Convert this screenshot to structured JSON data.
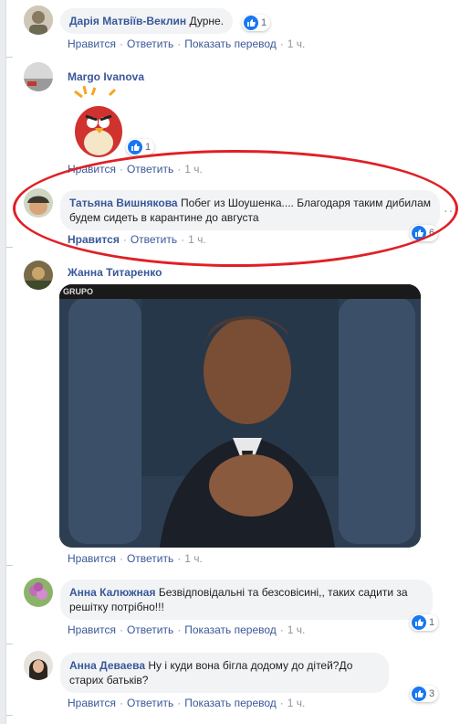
{
  "common": {
    "like": "Нравится",
    "reply": "Ответить",
    "translate": "Показать перевод",
    "sep": "·"
  },
  "colors": {
    "link": "#385898",
    "like_blue": "#1877f2",
    "bubble": "#f2f3f5",
    "highlight_oval": "#e01f26"
  },
  "comments": [
    {
      "name": "Дарія Матвіїв-Веклин",
      "text": "Дурне.",
      "time": "1 ч.",
      "reactions": "1"
    },
    {
      "name": "Margo Ivanova",
      "attachment": "angry-bird-sticker",
      "time": "1 ч.",
      "reactions": "1"
    },
    {
      "name": "Татьяна Вишнякова",
      "text": "Побег из Шоушенка.... Благодаря таким дибилам будем сидеть в карантине до августа",
      "time": "1 ч.",
      "reactions": "6",
      "liked": true
    },
    {
      "name": "Жанна Титаренко",
      "attachment": "gif-man-clapping",
      "time": "1 ч."
    },
    {
      "name": "Анна Калюжная",
      "text": "Безвідповідальні та безсовісині,, таких садити за решітку потрібно!!!",
      "time": "1 ч.",
      "reactions": "1"
    },
    {
      "name": "Анна Деваева",
      "text": "Ну і куди вона бігла додому до дітей?До старих батьків?",
      "time": "1 ч.",
      "reactions": "3"
    }
  ]
}
